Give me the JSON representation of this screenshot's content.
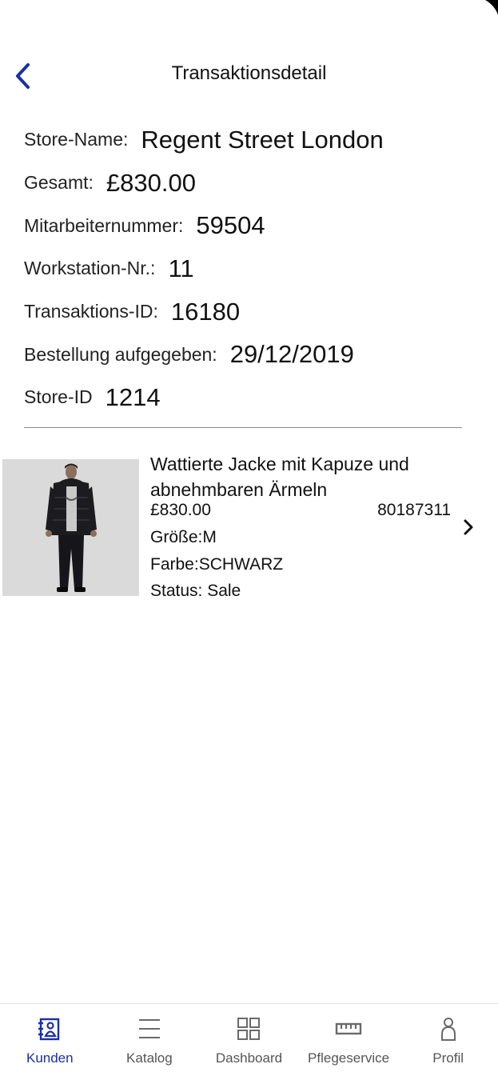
{
  "header": {
    "title": "Transaktionsdetail"
  },
  "colors": {
    "accent": "#1a2fa8",
    "text": "#111111",
    "muted": "#555555",
    "divider": "#8a8a8a"
  },
  "details": [
    {
      "label": "Store-Name:",
      "value": "Regent Street London"
    },
    {
      "label": "Gesamt:",
      "value": "£830.00"
    },
    {
      "label": "Mitarbeiternummer:",
      "value": "59504"
    },
    {
      "label": "Workstation-Nr.:",
      "value": "11"
    },
    {
      "label": "Transaktions-ID:",
      "value": "16180"
    },
    {
      "label": "Bestellung aufgegeben:",
      "value": "29/12/2019"
    },
    {
      "label": "Store-ID",
      "value": "1214"
    }
  ],
  "product": {
    "name": "Wattierte Jacke mit Kapuze und abnehmbaren Ärmeln",
    "price": "£830.00",
    "sku": "80187311",
    "size": "Größe:M",
    "color": "Farbe:SCHWARZ",
    "status": "Status: Sale"
  },
  "tabbar": {
    "items": [
      {
        "label": "Kunden",
        "icon": "customers-icon",
        "active": true
      },
      {
        "label": "Katalog",
        "icon": "menu-icon",
        "active": false
      },
      {
        "label": "Dashboard",
        "icon": "grid-icon",
        "active": false
      },
      {
        "label": "Pflegeservice",
        "icon": "ruler-icon",
        "active": false
      },
      {
        "label": "Profil",
        "icon": "person-icon",
        "active": false
      }
    ]
  }
}
